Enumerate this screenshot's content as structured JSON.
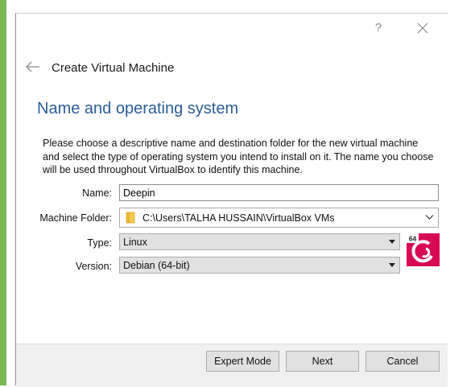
{
  "window": {
    "help_glyph": "?",
    "dialog_title": "Create Virtual Machine"
  },
  "page": {
    "heading": "Name and operating system",
    "description": "Please choose a descriptive name and destination folder for the new virtual machine and select the type of operating system you intend to install on it. The name you choose will be used throughout VirtualBox to identify this machine."
  },
  "form": {
    "name_label": "Name:",
    "name_value": "Deepin",
    "folder_label": "Machine Folder:",
    "folder_value": "C:\\Users\\TALHA HUSSAIN\\VirtualBox VMs",
    "type_label": "Type:",
    "type_value": "Linux",
    "version_label": "Version:",
    "version_value": "Debian (64-bit)"
  },
  "os_badge": {
    "bits_label": "64",
    "icon": "debian-icon",
    "accent_color": "#d70a53"
  },
  "buttons": {
    "expert_mode": "Expert Mode",
    "next": "Next",
    "cancel": "Cancel"
  },
  "colors": {
    "heading": "#2a5d97",
    "footer_bg": "#f0f0f0",
    "window_accent": "#7bb850"
  }
}
